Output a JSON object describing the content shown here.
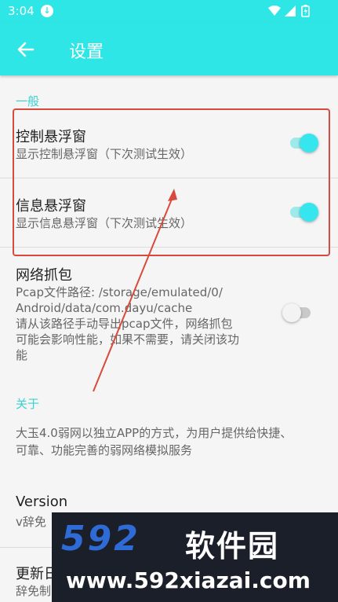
{
  "status_bar": {
    "time": "3:04"
  },
  "app_bar": {
    "title": "设置"
  },
  "general": {
    "header": "一般",
    "control_float": {
      "title": "控制悬浮窗",
      "subtitle": "显示控制悬浮窗（下次测试生效）",
      "enabled": true
    },
    "info_float": {
      "title": "信息悬浮窗",
      "subtitle": "显示信息悬浮窗（下次测试生效）",
      "enabled": true
    },
    "packet_capture": {
      "title": "网络抓包",
      "desc_lines": [
        "Pcap文件路径: /storage/emulated/0/",
        "Android/data/com.dayu/cache",
        "请从该路径手动导出pcap文件，网络抓包",
        "可能会影响性能，如果不需要，请关闭该功",
        "能"
      ],
      "enabled": false
    }
  },
  "about": {
    "header": "关于",
    "desc_lines": [
      "大玉4.0弱网以独立APP的方式，为用户提供给快捷、",
      "可靠、功能完善的弱网络模拟服务"
    ],
    "version": {
      "title": "Version",
      "value": "v辞免"
    },
    "update": {
      "title": "更新日",
      "value": "辞免制"
    }
  },
  "watermark": {
    "logo": "592",
    "logo_cn": "软件园",
    "url": "www.592xiazai.com"
  },
  "colors": {
    "accent": "#2ee6e6",
    "highlight": "#d94a3c",
    "arrow": "#d94a3c"
  },
  "icons": {
    "back": "arrow-left-icon",
    "download": "download-icon",
    "wifi": "wifi-icon",
    "signal": "signal-icon",
    "battery": "battery-icon"
  }
}
